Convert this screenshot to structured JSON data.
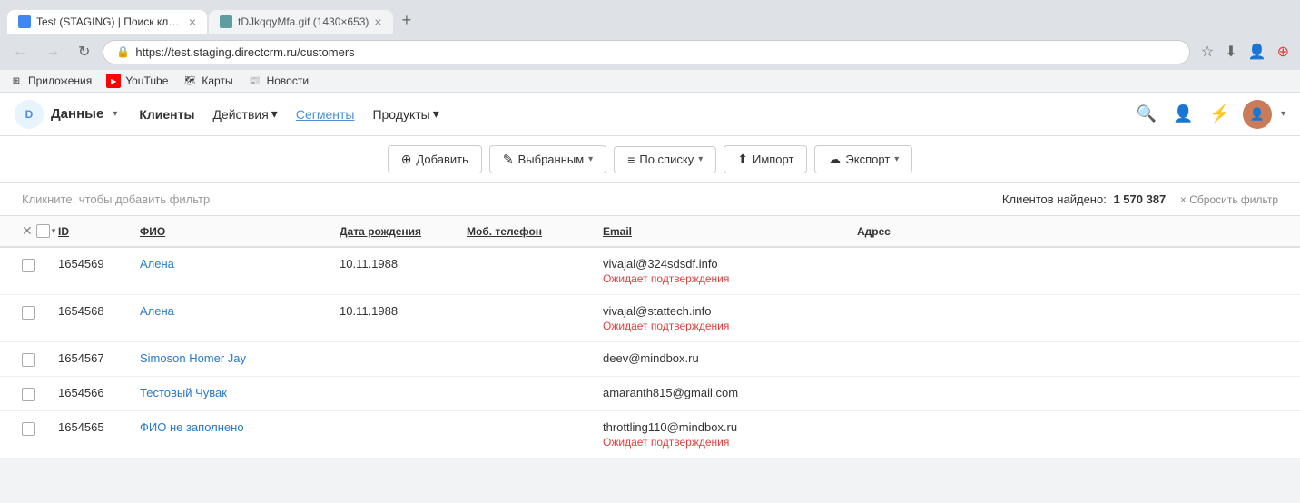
{
  "browser": {
    "tabs": [
      {
        "id": "tab1",
        "title": "Test (STAGING) | Поиск клие…",
        "active": true,
        "favicon_type": "blue"
      },
      {
        "id": "tab2",
        "title": "tDJkqqyMfa.gif (1430×653)",
        "active": false,
        "favicon_type": "doc"
      }
    ],
    "new_tab_label": "+",
    "address": "https://test.staging.directcrm.ru/customers",
    "nav": {
      "back": "←",
      "forward": "→",
      "reload": "↻"
    }
  },
  "bookmarks": [
    {
      "id": "apps",
      "label": "Приложения",
      "icon": "⊞"
    },
    {
      "id": "youtube",
      "label": "YouTube",
      "icon": "▶"
    },
    {
      "id": "maps",
      "label": "Карты",
      "icon": "📍"
    },
    {
      "id": "news",
      "label": "Новости",
      "icon": "📰"
    }
  ],
  "appbar": {
    "logo_letter": "D",
    "logo_label": "Данные",
    "logo_dropdown": "▾",
    "nav_items": [
      {
        "id": "clients",
        "label": "Клиенты",
        "active": true
      },
      {
        "id": "actions",
        "label": "Действия",
        "dropdown": true
      },
      {
        "id": "segments",
        "label": "Сегменты",
        "underlined": true
      },
      {
        "id": "products",
        "label": "Продукты",
        "dropdown": true
      }
    ]
  },
  "toolbar": {
    "add_label": "Добавить",
    "add_icon": "⊕",
    "selected_label": "Выбранным",
    "selected_icon": "✎",
    "list_label": "По списку",
    "list_icon": "≡",
    "import_label": "Импорт",
    "import_icon": "⬆",
    "export_label": "Экспорт",
    "export_icon": "☁"
  },
  "filter": {
    "placeholder": "Кликните, чтобы добавить фильтр",
    "result_label": "Клиентов найдено:",
    "result_count": "1 570 387",
    "reset_label": "× Сбросить фильтр"
  },
  "table": {
    "columns": {
      "id": "ID",
      "name": "ФИО",
      "dob": "Дата рождения",
      "phone": "Моб. телефон",
      "email": "Email",
      "address": "Адрес"
    },
    "rows": [
      {
        "id": "1654569",
        "name": "Алена",
        "dob": "10.11.1988",
        "phone": "",
        "email": "vivajal@324sdsdf.info",
        "email_status": "Ожидает подтверждения",
        "address": ""
      },
      {
        "id": "1654568",
        "name": "Алена",
        "dob": "10.11.1988",
        "phone": "",
        "email": "vivajal@stattech.info",
        "email_status": "Ожидает подтверждения",
        "address": ""
      },
      {
        "id": "1654567",
        "name": "Simoson Homer Jay",
        "dob": "",
        "phone": "",
        "email": "deev@mindbox.ru",
        "email_status": "",
        "address": ""
      },
      {
        "id": "1654566",
        "name": "Тестовый Чувак",
        "dob": "",
        "phone": "",
        "email": "amaranth815@gmail.com",
        "email_status": "",
        "address": ""
      },
      {
        "id": "1654565",
        "name": "ФИО не заполнено",
        "dob": "",
        "phone": "",
        "email": "throttling110@mindbox.ru",
        "email_status": "Ожидает подтверждения",
        "address": ""
      }
    ]
  }
}
